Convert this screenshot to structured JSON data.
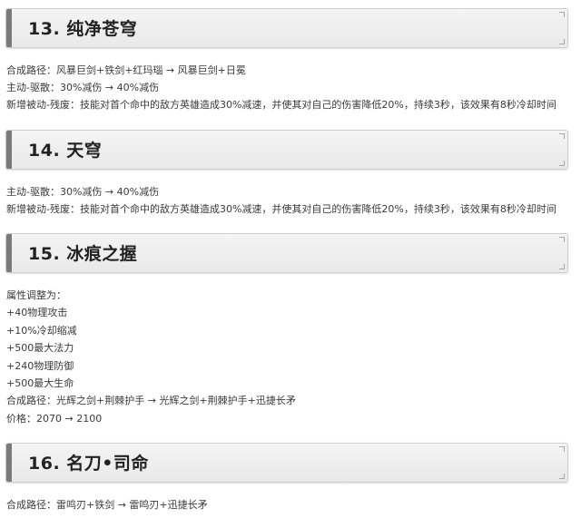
{
  "sections": [
    {
      "title": "13.  纯净苍穹",
      "lines": [
        "合成路径：风暴巨剑+铁剑+红玛瑙 → 风暴巨剑+日冕",
        "主动-驱散：30%减伤 → 40%减伤",
        "新增被动-残废：技能对首个命中的敌方英雄造成30%减速，并使其对自己的伤害降低20%，持续3秒，该效果有8秒冷却时间"
      ]
    },
    {
      "title": "14.  天穹",
      "lines": [
        "主动-驱散：30%减伤 → 40%减伤",
        "新增被动-残废：技能对首个命中的敌方英雄造成30%减速，并使其对自己的伤害降低20%，持续3秒，该效果有8秒冷却时间"
      ]
    },
    {
      "title": "15.  冰痕之握",
      "lines": [
        "属性调整为：",
        "+40物理攻击",
        "+10%冷却缩减",
        "+500最大法力",
        "+240物理防御",
        "+500最大生命",
        "合成路径：光辉之剑+荆棘护手 → 光辉之剑+荆棘护手+迅捷长矛",
        "价格：2070 → 2100"
      ]
    },
    {
      "title": "16.  名刀•司命",
      "lines": [
        "合成路径：雷鸣刃+铁剑 → 雷鸣刃+迅捷长矛"
      ]
    }
  ]
}
